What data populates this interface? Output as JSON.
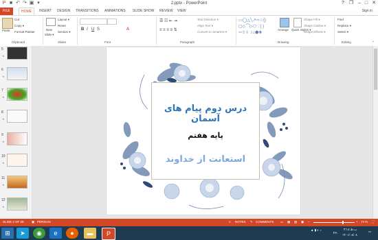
{
  "app": {
    "title": "2.pptx - PowerPoint",
    "sign_in": "Sign in"
  },
  "qat": {
    "save": "■",
    "undo": "↶",
    "redo": "↷",
    "start": "▣",
    "more": "▾"
  },
  "window": {
    "help": "?",
    "restore": "❐",
    "minimize": "–",
    "maximize": "□",
    "close": "✕"
  },
  "tabs": [
    "FILE",
    "HOME",
    "INSERT",
    "DESIGN",
    "TRANSITIONS",
    "ANIMATIONS",
    "SLIDE SHOW",
    "REVIEW",
    "VIEW"
  ],
  "ribbon": {
    "clipboard": {
      "label": "Clipboard",
      "paste": "Paste",
      "cut": "Cut",
      "copy": "Copy ▾",
      "format_painter": "Format Painter"
    },
    "slides": {
      "label": "Slides",
      "new_slide": "New",
      "new_slide2": "Slide ▾",
      "layout": "Layout ▾",
      "reset": "Reset",
      "section": "Section ▾"
    },
    "font": {
      "label": "Font"
    },
    "paragraph": {
      "label": "Paragraph",
      "text_direction": "Text Direction ▾",
      "align_text": "Align Text ▾",
      "convert_smartart": "Convert to SmartArt ▾"
    },
    "drawing": {
      "label": "Drawing",
      "arrange": "Arrange",
      "quick_styles": "Quick Styles ▾",
      "shape_fill": "Shape Fill ▾",
      "shape_outline": "Shape Outline ▾",
      "shape_effects": "Shape Effects ▾"
    },
    "editing": {
      "label": "Editing",
      "find": "Find",
      "replace": "Replace ▾",
      "select": "Select ▾"
    }
  },
  "thumbnails": [
    {
      "num": "5"
    },
    {
      "num": "6"
    },
    {
      "num": "7"
    },
    {
      "num": "8"
    },
    {
      "num": "9"
    },
    {
      "num": "10"
    },
    {
      "num": "11"
    },
    {
      "num": "12"
    }
  ],
  "slide": {
    "line1": "درس دوم پیام های آسمان",
    "line2": "پایه هفتم",
    "line3": "استعانت از خداوند"
  },
  "status": {
    "slide_of": "SLIDE 2 OF 29",
    "language": "PERSIAN",
    "notes": "NOTES",
    "comments": "COMMENTS",
    "zoom": "74 %"
  },
  "colors": {
    "accent": "#d24726",
    "title_blue": "#2e75b6",
    "subtitle_blue": "#7fa8d8"
  },
  "tray": {
    "time": "۳:۱۸ ب.ظ",
    "date": "۱۴۰۱/۰۸/۰۸",
    "lang": "FA"
  }
}
